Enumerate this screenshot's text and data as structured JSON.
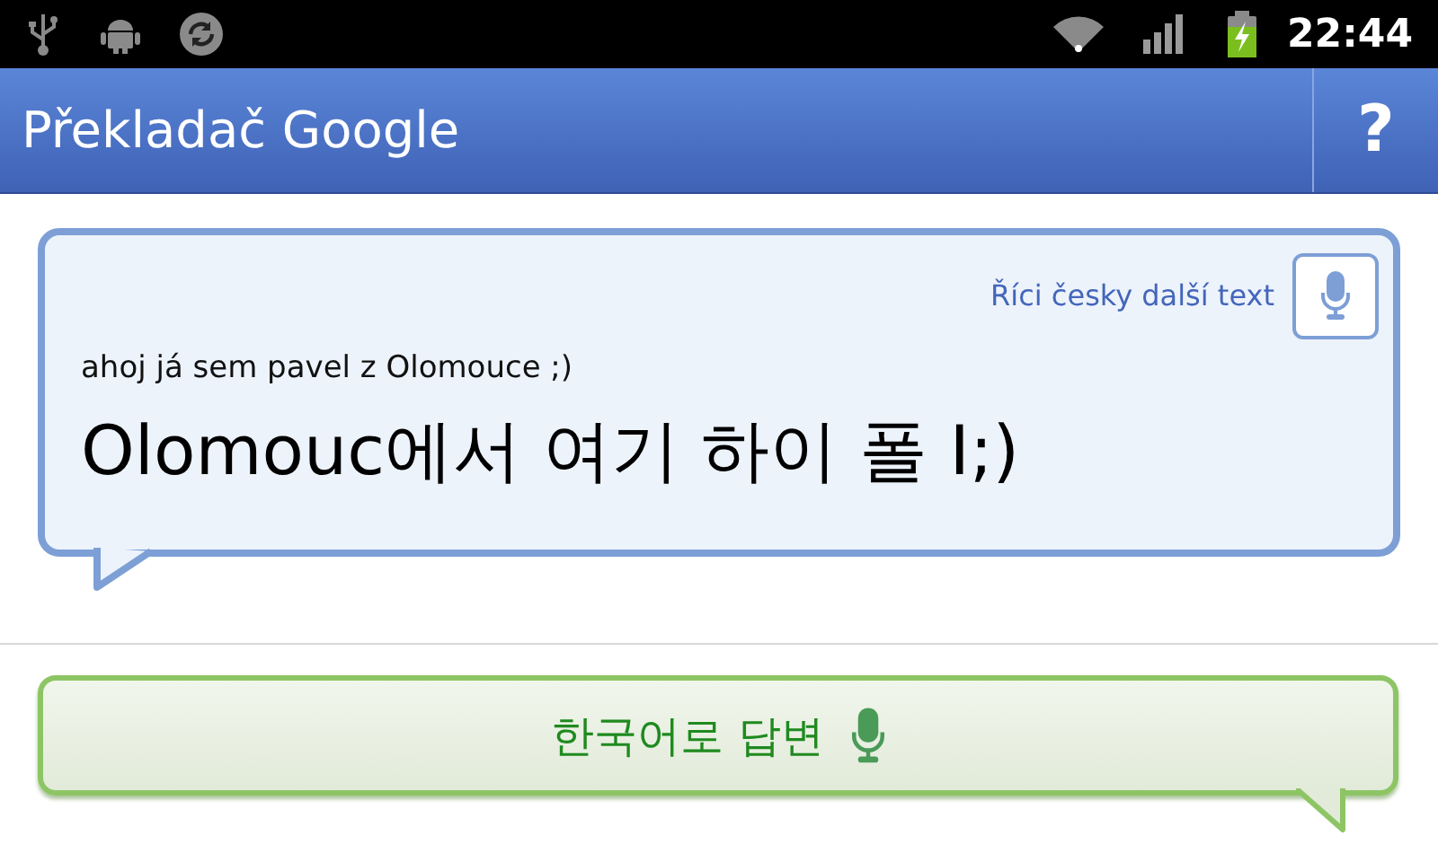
{
  "status_bar": {
    "time": "22:44"
  },
  "app_bar": {
    "title": "Překladač Google",
    "help": "?"
  },
  "translation_card": {
    "speak_link": "Říci česky další text",
    "source_text": "ahoj já sem pavel z Olomouce ;)",
    "translated_text": "Olomouc에서 여기 하이 폴 I;)"
  },
  "reply_button": {
    "label": "한국어로 답변"
  }
}
